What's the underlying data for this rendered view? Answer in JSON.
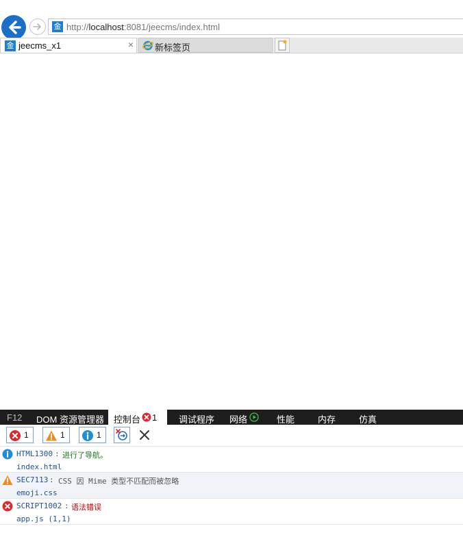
{
  "browser": {
    "address": {
      "prefix": "http://",
      "host": "localhost",
      "rest": ":8081/jeecms/index.html",
      "favicon": "金"
    },
    "tabs": [
      {
        "label": "jeecms_x1",
        "favicon": "金",
        "close": "×"
      },
      {
        "label": "新标签页"
      }
    ]
  },
  "devtools": {
    "tabs": {
      "f12": "F12",
      "dom": "DOM 资源管理器",
      "console": "控制台",
      "console_count": "1",
      "debugger": "调试程序",
      "network": "网络",
      "performance": "性能",
      "memory": "内存",
      "emulation": "仿真"
    },
    "filters": {
      "errors": "1",
      "warnings": "1",
      "info": "1"
    },
    "messages": [
      {
        "level": "info",
        "code": "HTML1300",
        "sep": ": ",
        "text": "进行了导航。",
        "source": "index.html",
        "text_color": "#1a7a1a"
      },
      {
        "level": "warning",
        "code": "SEC7113",
        "sep": ": ",
        "text": "CSS 因 Mime 类型不匹配而被忽略",
        "source": "emoji.css",
        "text_color": "#555555"
      },
      {
        "level": "error",
        "code": "SCRIPT1002",
        "sep": ": ",
        "text": "语法错误",
        "source": "app.js (1,1)",
        "text_color": "#cc0000"
      }
    ]
  },
  "colors": {
    "info": "#1e8fd6",
    "warning": "#f08a1c",
    "error": "#e0262f",
    "accent": "#1b6fc7"
  }
}
